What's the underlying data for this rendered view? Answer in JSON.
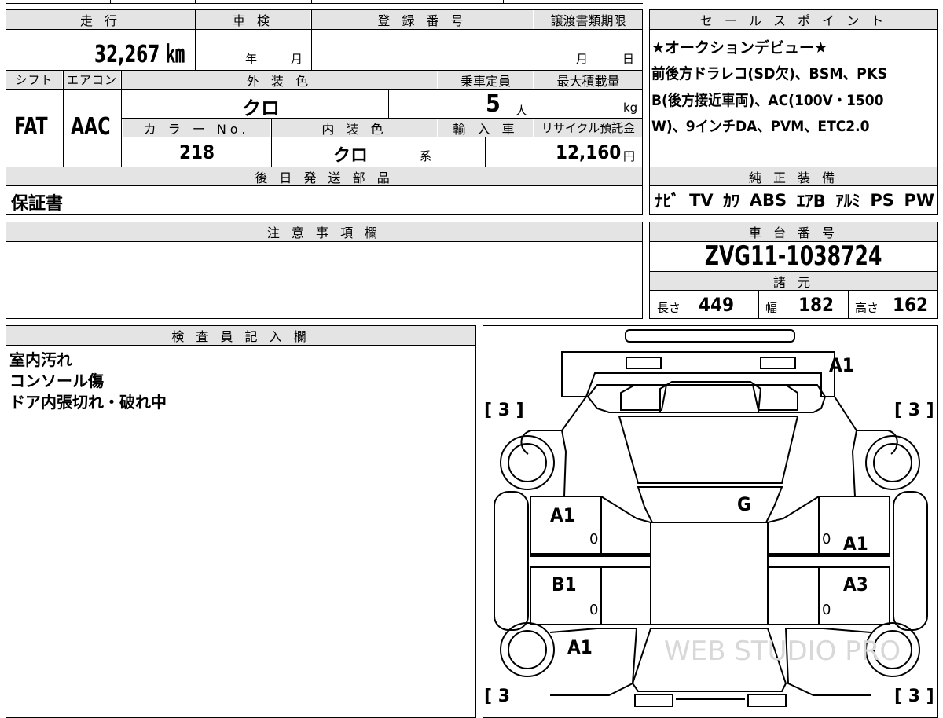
{
  "top_table": {
    "mileage_label": "走 行",
    "mileage_value": "32,267 ㎞",
    "inspection_label": "車 検",
    "inspection_year": "年",
    "inspection_month": "月",
    "reg_number_label": "登 録 番 号",
    "transfer_deadline_label": "譲渡書類期限",
    "transfer_month": "月",
    "transfer_day": "日",
    "shift_label": "シフト",
    "aircon_label": "エアコン",
    "exterior_color_label": "外 装 色",
    "capacity_label": "乗車定員",
    "max_load_label": "最大積載量",
    "shift_value": "FAT",
    "aircon_value": "AAC",
    "exterior_color_value": "クロ",
    "capacity_value": "5",
    "capacity_unit": "人",
    "max_load_unit": "kg",
    "color_no_label": "カ ラ ー No.",
    "interior_color_label": "内 装 色",
    "import_label": "輸 入 車",
    "recycle_label": "リサイクル預託金",
    "color_no_value": "218",
    "interior_color_value": "クロ",
    "interior_color_suffix": "系",
    "recycle_value": "12,160",
    "recycle_unit": "円",
    "later_parts_label": "後 日 発 送 部 品",
    "later_parts_value": "保証書"
  },
  "sales_points": {
    "label": "セ ー ル ス ポ イ ン ト",
    "lines": [
      "★オークションデビュー★",
      "前後方ドラレコ(SD欠)、BSM、PKS",
      "B(後方接近車両)、AC(100V・1500",
      "W)、9インチDA、PVM、ETC2.0"
    ]
  },
  "equipment": {
    "label": "純 正 装 備",
    "items": [
      "ﾅﾋﾞ",
      "TV",
      "ｶﾜ",
      "ABS",
      "ｴｱB",
      "ｱﾙﾐ",
      "PS",
      "PW"
    ]
  },
  "notes": {
    "label": "注 意 事 項 欄"
  },
  "chassis": {
    "label": "車 台 番 号",
    "value": "ZVG11-1038724"
  },
  "specs": {
    "label": "諸 元",
    "length_label": "長さ",
    "length_value": "449",
    "width_label": "幅",
    "width_value": "182",
    "height_label": "高さ",
    "height_value": "162"
  },
  "inspector": {
    "label": "検 査 員 記 入 欄",
    "lines": [
      "室内汚れ",
      "コンソール傷",
      "ドア内張切れ・破れ中"
    ]
  },
  "diagram": {
    "marks": {
      "rear_top": "A1",
      "roof": "G",
      "left_front_door": "A1",
      "left_rear_door": "B1",
      "left_rear_fender": "A1",
      "right_front_door": "A1",
      "right_rear_door": "A3",
      "door_zero_1": "0",
      "door_zero_2": "0",
      "door_zero_3": "0",
      "door_zero_4": "0"
    },
    "tires": {
      "tl": "[ 3 ]",
      "tr": "[ 3 ]",
      "bl": "[ 3",
      "br": "[ 3 ]"
    },
    "watermark": "WEB STUDIO PRO"
  }
}
